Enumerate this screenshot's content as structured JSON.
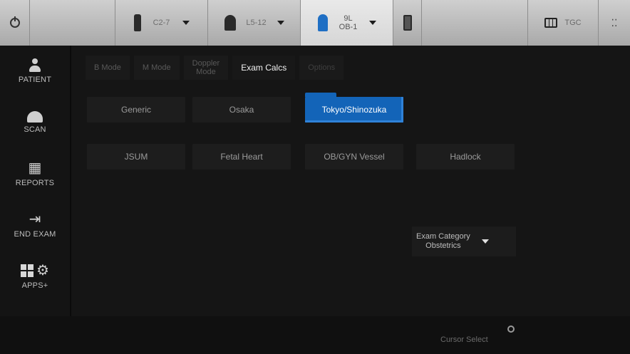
{
  "topbar": {
    "probes": [
      {
        "name": "C2-7"
      },
      {
        "name": "L5-12"
      },
      {
        "name_line1": "9L",
        "name_line2": "OB-1"
      }
    ],
    "tgc_label": "TGC",
    "dots": "⁚⁚"
  },
  "sidebar": {
    "items": [
      {
        "label": "PATIENT"
      },
      {
        "label": "SCAN"
      },
      {
        "label": "REPORTS"
      },
      {
        "label": "END EXAM"
      },
      {
        "label": "APPS+"
      }
    ]
  },
  "tabs": [
    {
      "label": "B Mode"
    },
    {
      "label": "M Mode"
    },
    {
      "label_line1": "Doppler",
      "label_line2": "Mode"
    },
    {
      "label": "Exam Calcs"
    },
    {
      "label": "Options"
    }
  ],
  "calc_buttons": {
    "row1": [
      {
        "label": "Generic"
      },
      {
        "label": "Osaka"
      },
      {
        "label": "Tokyo/Shinozuka"
      }
    ],
    "row2": [
      {
        "label": "JSUM"
      },
      {
        "label": "Fetal Heart"
      },
      {
        "label": "OB/GYN Vessel"
      },
      {
        "label": "Hadlock"
      }
    ]
  },
  "exam_category": {
    "label": "Exam Category",
    "value": "Obstetrics"
  },
  "bottombar": {
    "cursor_select": "Cursor Select"
  },
  "colors": {
    "selected_blue": "#1364b8"
  }
}
